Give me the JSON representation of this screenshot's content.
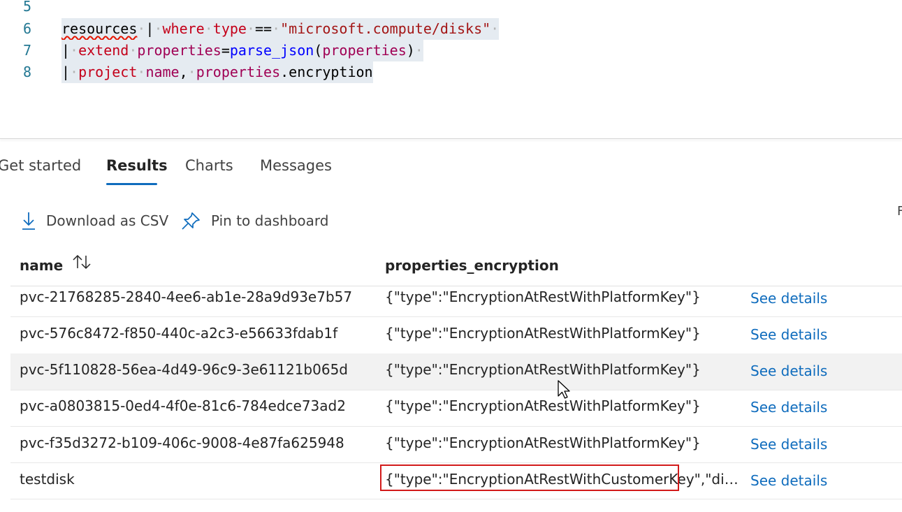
{
  "editor": {
    "lines": [
      {
        "num": "5"
      },
      {
        "num": "6"
      },
      {
        "num": "7"
      },
      {
        "num": "8"
      }
    ],
    "tokens": {
      "l6_resources": "resources",
      "l6_pipe": "|",
      "l6_where": "where",
      "l6_type": "type",
      "l6_eq": "==",
      "l6_str": "\"microsoft.compute/disks\"",
      "l7_pipe": "|",
      "l7_extend": "extend",
      "l7_properties": "properties",
      "l7_assign": "=",
      "l7_parse": "parse_json",
      "l7_open": "(",
      "l7_arg": "properties",
      "l7_close": ")",
      "l8_pipe": "|",
      "l8_project": "project",
      "l8_name": "name",
      "l8_comma": ",",
      "l8_props": "properties",
      "l8_dot": ".encryption"
    }
  },
  "tabs": [
    {
      "label": "Get started"
    },
    {
      "label": "Results"
    },
    {
      "label": "Charts"
    },
    {
      "label": "Messages"
    }
  ],
  "toolbar": {
    "download_label": "Download as CSV",
    "pin_label": "Pin to dashboard",
    "edge_char": "F"
  },
  "table": {
    "columns": [
      {
        "label": "name"
      },
      {
        "label": "properties_encryption"
      }
    ],
    "rows": [
      {
        "name": "pvc-21768285-2840-4ee6-ab1e-28a9d93e7b57",
        "encryption": "{\"type\":\"EncryptionAtRestWithPlatformKey\"}",
        "action": "See details"
      },
      {
        "name": "pvc-576c8472-f850-440c-a2c3-e56633fdab1f",
        "encryption": "{\"type\":\"EncryptionAtRestWithPlatformKey\"}",
        "action": "See details"
      },
      {
        "name": "pvc-5f110828-56ea-4d49-96c9-3e61121b065d",
        "encryption": "{\"type\":\"EncryptionAtRestWithPlatformKey\"}",
        "action": "See details"
      },
      {
        "name": "pvc-a0803815-0ed4-4f0e-81c6-784edce73ad2",
        "encryption": "{\"type\":\"EncryptionAtRestWithPlatformKey\"}",
        "action": "See details"
      },
      {
        "name": "pvc-f35d3272-b109-406c-9008-4e87fa625948",
        "encryption": "{\"type\":\"EncryptionAtRestWithPlatformKey\"}",
        "action": "See details"
      },
      {
        "name": "testdisk",
        "encryption": "{\"type\":\"EncryptionAtRestWithCustomerKey\",\"diskEn...",
        "action": "See details"
      }
    ]
  },
  "colors": {
    "accent": "#0f6cbd",
    "highlight_box": "#d21a1a",
    "line_number": "#237893"
  }
}
